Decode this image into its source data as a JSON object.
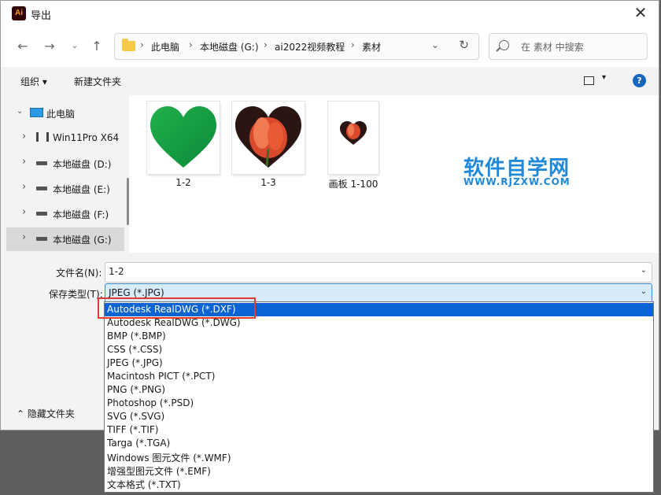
{
  "window": {
    "title": "导出",
    "app_icon": "Ai",
    "close_glyph": "✕"
  },
  "address": {
    "crumbs": [
      "此电脑",
      "本地磁盘 (G:)",
      "ai2022视频教程",
      "素材"
    ],
    "separator": "›",
    "search_placeholder": "在 素材 中搜索"
  },
  "toolbar": {
    "organize": "组织 ▾",
    "new_folder": "新建文件夹",
    "help": "?"
  },
  "sidebar": {
    "items": [
      {
        "label": "此电脑",
        "icon": "computer-icon",
        "chevron": "⌄"
      },
      {
        "label": "Win11Pro X64",
        "icon": "network-icon",
        "chevron": "›"
      },
      {
        "label": "本地磁盘 (D:)",
        "icon": "drive-icon",
        "chevron": "›"
      },
      {
        "label": "本地磁盘 (E:)",
        "icon": "drive-icon",
        "chevron": "›"
      },
      {
        "label": "本地磁盘 (F:)",
        "icon": "drive-icon",
        "chevron": "›"
      },
      {
        "label": "本地磁盘 (G:)",
        "icon": "drive-icon",
        "chevron": "›",
        "selected": true
      }
    ]
  },
  "files": [
    {
      "name": "1-2",
      "thumb": "green-heart",
      "color": "#119b3f"
    },
    {
      "name": "1-3",
      "thumb": "tulip-heart",
      "color": "#d94a2c"
    },
    {
      "name": "画板 1-100",
      "thumb": "small-tulip-heart",
      "color": "#d94a2c"
    }
  ],
  "watermark": {
    "cn": "软件自学网",
    "en": "WWW.RJZXW.COM",
    "color": "#1f88d8"
  },
  "form": {
    "filename_label": "文件名(N):",
    "filename_value": "1-2",
    "filetype_label": "保存类型(T):",
    "filetype_value": "JPEG (*.JPG)",
    "dd_glyph": "⌄"
  },
  "hide_folders": "⌃  隐藏文件夹",
  "filetype_options": [
    "Autodesk RealDWG (*.DXF)",
    "Autodesk RealDWG (*.DWG)",
    "BMP (*.BMP)",
    "CSS (*.CSS)",
    "JPEG (*.JPG)",
    "Macintosh PICT (*.PCT)",
    "PNG (*.PNG)",
    "Photoshop (*.PSD)",
    "SVG (*.SVG)",
    "TIFF (*.TIF)",
    "Targa (*.TGA)",
    "Windows 图元文件 (*.WMF)",
    "增强型图元文件 (*.EMF)",
    "文本格式 (*.TXT)"
  ],
  "highlighted_option": "Autodesk RealDWG (*.DXF)",
  "highlight_color": "#e53935"
}
